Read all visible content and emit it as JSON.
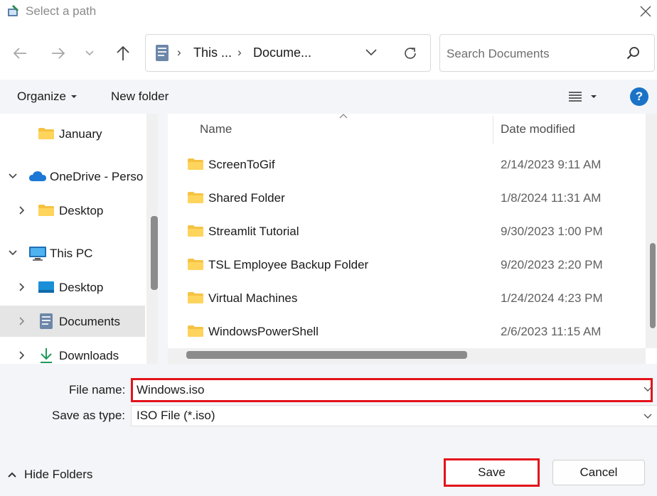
{
  "window": {
    "title": "Select a path",
    "close_icon": "close-icon"
  },
  "nav": {
    "back_icon": "arrow-left-icon",
    "forward_icon": "arrow-right-icon",
    "recent_icon": "chevron-down-icon",
    "up_icon": "arrow-up-icon"
  },
  "address": {
    "crumbs": [
      "This ...",
      "Docume..."
    ],
    "separator": "›",
    "location_icon": "documents-icon",
    "dropdown_icon": "chevron-down-icon",
    "refresh_icon": "refresh-icon"
  },
  "search": {
    "placeholder": "Search Documents",
    "icon": "search-icon"
  },
  "toolbar": {
    "organize_label": "Organize",
    "new_folder_label": "New folder",
    "view_icon": "list-view-icon",
    "help_label": "?",
    "help_color": "#1a73c7"
  },
  "sidebar": {
    "items": [
      {
        "label": "January",
        "icon": "folder-icon",
        "expandable": false,
        "selected": false
      },
      {
        "label": "OneDrive - Perso",
        "icon": "cloud-icon",
        "expanded": true,
        "selected": false
      },
      {
        "label": "Desktop",
        "icon": "folder-icon",
        "expanded": false,
        "selected": false
      },
      {
        "label": "This PC",
        "icon": "computer-icon",
        "expanded": true,
        "selected": false
      },
      {
        "label": "Desktop",
        "icon": "desktop-icon",
        "expanded": false,
        "selected": false
      },
      {
        "label": "Documents",
        "icon": "documents-icon",
        "expanded": false,
        "selected": true
      },
      {
        "label": "Downloads",
        "icon": "download-icon",
        "expanded": false,
        "selected": false
      }
    ]
  },
  "file_list": {
    "columns": {
      "name": "Name",
      "date": "Date modified"
    },
    "rows": [
      {
        "name": "ScreenToGif",
        "date": "2/14/2023 9:11 AM"
      },
      {
        "name": "Shared Folder",
        "date": "1/8/2024 11:31 AM"
      },
      {
        "name": "Streamlit Tutorial",
        "date": "9/30/2023 1:00 PM"
      },
      {
        "name": "TSL Employee Backup Folder",
        "date": "9/20/2023 2:20 PM"
      },
      {
        "name": "Virtual Machines",
        "date": "1/24/2024 4:23 PM"
      },
      {
        "name": "WindowsPowerShell",
        "date": "2/6/2023 11:15 AM"
      }
    ]
  },
  "form": {
    "file_name_label": "File name:",
    "file_name_value": "Windows.iso",
    "save_type_label": "Save as type:",
    "save_type_value": "ISO File (*.iso)"
  },
  "footer": {
    "hide_folders_label": "Hide Folders",
    "save_label": "Save",
    "cancel_label": "Cancel"
  },
  "colors": {
    "highlight": "#e4121b",
    "folder": "#f5c242",
    "accent": "#1a73c7"
  }
}
